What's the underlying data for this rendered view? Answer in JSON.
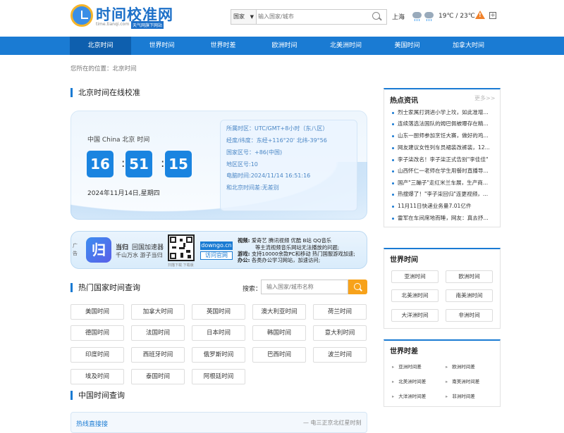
{
  "header": {
    "logo_title": "时间校准网",
    "logo_url": "time.tianqi.com",
    "logo_sub": "天气网旗下网站",
    "country_select": "国家",
    "search_placeholder": "输入国家/城市",
    "city": "上海",
    "temperature": "19℃ / 23℃",
    "warning_icon": "warning-icon",
    "plus_icon": "add-icon"
  },
  "nav": [
    "北京时间",
    "世界时间",
    "世界时差",
    "欧洲时间",
    "北美洲时间",
    "美国时间",
    "加拿大时间"
  ],
  "breadcrumb": "您所在的位置：北京时间",
  "clock": {
    "section_title": "北京时间在线校准",
    "location": "中国 China 北京 时间",
    "hours": "16",
    "minutes": "51",
    "seconds": "15",
    "date": "2024年11月14日,星期四",
    "info": [
      "所属时区：UTC/GMT+8小时（东八区）",
      "经度/纬度：东经+116°20' 北纬-39°56",
      "国家区号：+86(中国)",
      "地区区号:10",
      "电脑时间:2024/11/14 16:51:16",
      "和北京时间差:无差别"
    ]
  },
  "ad": {
    "tag": "广告",
    "logo_char": "归",
    "brand": "当归",
    "brand_sub": "回国加速器",
    "slogan": "千山万水 游子当归",
    "qr_caption": "扫描下载 下载版",
    "domain": "downgo.cn",
    "visit": "访问官网",
    "lines": [
      {
        "k": "视频:",
        "v": "爱奇艺 腾讯视频 优酷 B站 QQ音乐"
      },
      {
        "k": "",
        "v": "等主流视频音乐网站无法播放的问题;"
      },
      {
        "k": "游戏:",
        "v": "支持10000余款PC和移动 热门国服游戏加速;"
      },
      {
        "k": "办公:",
        "v": "各类办公学习网站，加速访问;"
      }
    ]
  },
  "popular": {
    "section_title": "热门国家时间查询",
    "search_label": "搜索：",
    "search_placeholder": "输入国家/城市名称",
    "countries": [
      "美国时间",
      "加拿大时间",
      "英国时间",
      "澳大利亚时间",
      "荷兰时间",
      "德国时间",
      "法国时间",
      "日本时间",
      "韩国时间",
      "意大利时间",
      "印度时间",
      "西班牙时间",
      "俄罗斯时间",
      "巴西时间",
      "波兰时间",
      "埃及时间",
      "泰国时间",
      "阿根廷时间"
    ]
  },
  "china": {
    "section_title": "中国时间查询",
    "left": "热线直接接",
    "right": "— 电三正京北红星时刻"
  },
  "sidebar": {
    "hot_title": "热点资讯",
    "more": "更多>>",
    "news": [
      "烈士家属打洞进小学上坟，如此准增...",
      "连续落选法国队的姆巴佩被曝存在精...",
      "山东一厨师参加烹饪大赛，做好的鸡...",
      "网友建议女性列车员裙装改裤装，12...",
      "李子柒改名！李子柒正式告别\"李佳佳\"",
      "山西怀仁一老师在学生用餐时直播导...",
      "国产\"三蹦子\"走红米兰车展，生产商...",
      "热搜爆了！\"李子柒回归\"连更视频，...",
      "11月11日快递业务量7.01亿件",
      "雷军在车间席地而睡，网友：真去抒..."
    ],
    "world_time_title": "世界时间",
    "world_time": [
      "亚洲时间",
      "欧洲时间",
      "北美洲时间",
      "南美洲时间",
      "大洋洲时间",
      "非洲时间"
    ],
    "world_diff_title": "世界时差",
    "world_diff": [
      "亚洲时间差",
      "欧洲时间差",
      "北美洲时间差",
      "南美洲时间差",
      "大洋洲时间差",
      "非洲时间差"
    ]
  }
}
